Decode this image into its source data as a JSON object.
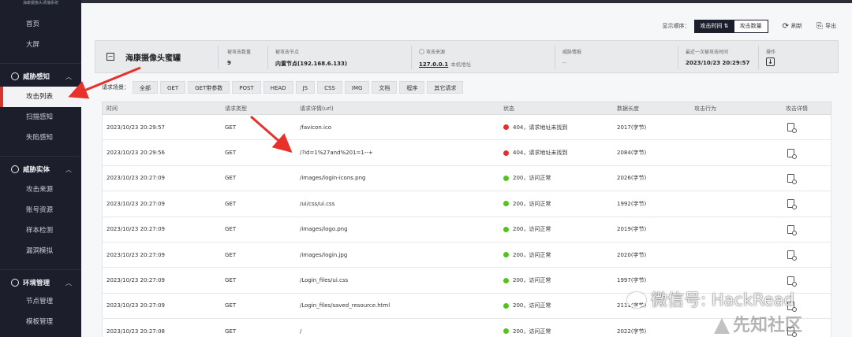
{
  "sidebar": {
    "logo_text": "海康摄像头诱捕系统",
    "top_items": [
      "首页",
      "大屏"
    ],
    "groups": [
      {
        "label": "威胁感知",
        "items": [
          "攻击列表",
          "扫描感知",
          "失陷感知"
        ]
      },
      {
        "label": "威胁实体",
        "items": [
          "攻击来源",
          "账号资源",
          "样本检测",
          "漏洞模拟"
        ]
      },
      {
        "label": "环境管理",
        "items": [
          "节点管理",
          "模板管理"
        ]
      }
    ],
    "active_item": "攻击列表"
  },
  "toolbar": {
    "order_label": "显示顺序：",
    "order_options": [
      "攻击时间",
      "攻击数量"
    ],
    "order_selected_suffix": "⇅",
    "refresh_label": "刷新",
    "export_label": "导出"
  },
  "card": {
    "title": "海康摄像头蜜罐",
    "fields": {
      "count_key": "被攻击数量",
      "count_value": "9",
      "node_key": "被攻击节点",
      "node_value": "内置节点(192.168.6.133)",
      "source_key": "攻击来源",
      "source_value": "127.0.0.1",
      "source_sub": "本机地址",
      "intel_key": "威胁情报",
      "intel_value": "--",
      "last_key": "最近一次被攻击时间",
      "last_value": "2023/10/23 20:29:57",
      "op_key": "操作"
    }
  },
  "filters": {
    "label": "请求场景：",
    "chips": [
      "全部",
      "GET",
      "GET带参数",
      "POST",
      "HEAD",
      "JS",
      "CSS",
      "IMG",
      "文档",
      "程序",
      "其它请求"
    ]
  },
  "table": {
    "headers": [
      "时间",
      "请求类型",
      "请求详情(url)",
      "状态",
      "数据长度",
      "攻击行为",
      "攻击详情"
    ],
    "rows": [
      {
        "time": "2023/10/23 20:29:57",
        "type": "GET",
        "url": "/favicon.ico",
        "status": "404，请求地址未找到",
        "status_color": "#e5302d",
        "length": "2017(字节)"
      },
      {
        "time": "2023/10/23 20:29:56",
        "type": "GET",
        "url": "/?id=1%27and%201=1--+",
        "status": "404，请求地址未找到",
        "status_color": "#e5302d",
        "length": "2084(字节)"
      },
      {
        "time": "2023/10/23 20:27:09",
        "type": "GET",
        "url": "/images/login-icons.png",
        "status": "200，访问正常",
        "status_color": "#52c41a",
        "length": "2026(字节)"
      },
      {
        "time": "2023/10/23 20:27:09",
        "type": "GET",
        "url": "/ui/css/ui.css",
        "status": "200，访问正常",
        "status_color": "#52c41a",
        "length": "1992(字节)"
      },
      {
        "time": "2023/10/23 20:27:09",
        "type": "GET",
        "url": "/images/logo.png",
        "status": "200，访问正常",
        "status_color": "#52c41a",
        "length": "2019(字节)"
      },
      {
        "time": "2023/10/23 20:27:09",
        "type": "GET",
        "url": "/images/login.jpg",
        "status": "200，访问正常",
        "status_color": "#52c41a",
        "length": "2020(字节)"
      },
      {
        "time": "2023/10/23 20:27:09",
        "type": "GET",
        "url": "/Login_files/ui.css",
        "status": "200，访问正常",
        "status_color": "#52c41a",
        "length": "1997(字节)"
      },
      {
        "time": "2023/10/23 20:27:09",
        "type": "GET",
        "url": "/Login_files/saved_resource.html",
        "status": "200，访问正常",
        "status_color": "#52c41a",
        "length": "2111(字节)"
      },
      {
        "time": "2023/10/23 20:27:08",
        "type": "GET",
        "url": "/",
        "status": "200，访问正常",
        "status_color": "#52c41a",
        "length": "2022(字节)"
      }
    ]
  },
  "watermarks": {
    "wechat": "微信号: HackRead",
    "xianzhi": "先知社区"
  },
  "colors": {
    "sidebar_bg": "#1c1f2b",
    "accent_red": "#d6342c",
    "ok_green": "#52c41a",
    "err_red": "#e5302d"
  }
}
